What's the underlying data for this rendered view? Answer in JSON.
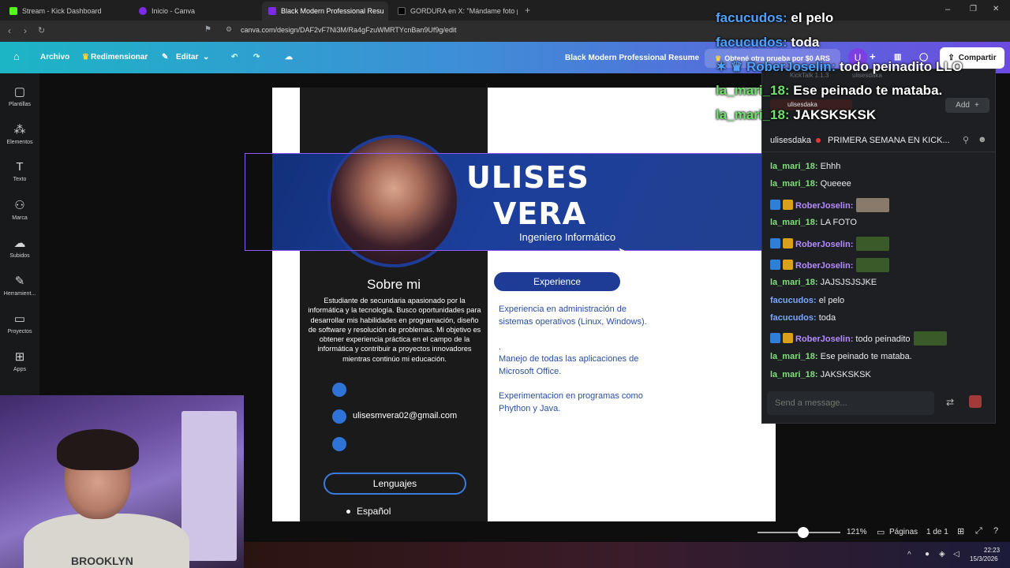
{
  "browser": {
    "tabs": [
      {
        "label": "Stream - Kick Dashboard",
        "color": "#53fc18"
      },
      {
        "label": "Inicio - Canva",
        "color": "#7d2ae8"
      },
      {
        "label": "Black Modern Professional Resu",
        "color": "#7d2ae8"
      },
      {
        "label": "GORDURA en X: \"Mándame foto par",
        "color": "#000000"
      }
    ],
    "url": "canva.com/design/DAF2vF7Ni3M/Ra4gFzuWMRTYcnBan9Uf9g/edit"
  },
  "canva": {
    "menu": {
      "file": "Archivo",
      "resize": "Redimensionar",
      "edit": "Editar"
    },
    "doc_title": "Black Modern Professional Resume",
    "trial": "Obtené otra prueba por $0 ARS",
    "avatar": "U",
    "share": "Compartir",
    "sidebar": [
      {
        "label": "Plantillas",
        "icon": "template-icon"
      },
      {
        "label": "Elementos",
        "icon": "elements-icon"
      },
      {
        "label": "Texto",
        "icon": "text-icon"
      },
      {
        "label": "Marca",
        "icon": "brand-icon"
      },
      {
        "label": "Subidos",
        "icon": "upload-icon"
      },
      {
        "label": "Herramient...",
        "icon": "tools-icon"
      },
      {
        "label": "Proyectos",
        "icon": "folder-icon"
      },
      {
        "label": "Apps",
        "icon": "apps-icon"
      }
    ],
    "status": {
      "zoom": "121%",
      "pages_label": "Páginas",
      "page_count": "1 de 1",
      "zoom_level": 0.55
    }
  },
  "resume": {
    "first_name": "ULISES",
    "last_name": "VERA",
    "role": "Ingeniero Informático",
    "about_heading": "Sobre mi",
    "about_text": "Estudiante de secundaria apasionado por la informática y la tecnología. Busco oportunidades para desarrollar mis habilidades en programación, diseño de software y resolución de problemas. Mi objetivo es obtener experiencia práctica en el campo de la informática y contribuir a proyectos innovadores mientras continúo mi educación.",
    "email": "ulisesmvera02@gmail.com",
    "languages_heading": "Lenguajes",
    "language_1": "Español",
    "experience_heading": "Experience",
    "experience_1": "Experiencia en administración de sistemas operativos (Linux, Windows).",
    "experience_dot": ".",
    "experience_2": "Manejo de todas las aplicaciones de Microsoft Office.",
    "experience_3": "Experimentacion en programas como Phython y Java."
  },
  "kicktalk": {
    "window_title": "KickTalk 1.1.3",
    "window_user": "ulisesdaka",
    "channel_tab": "ulisesdaka",
    "add_label": "Add",
    "streamer": "ulisesdaka",
    "stream_title": "PRIMERA SEMANA EN KICK...",
    "messages": [
      {
        "user": "la_mari_18",
        "text": "Ehhh"
      },
      {
        "user": "la_mari_18",
        "text": "Queeee"
      },
      {
        "user": "RoberJoselin",
        "text": ""
      },
      {
        "user": "la_mari_18",
        "text": "LA FOTO"
      },
      {
        "user": "RoberJoselin",
        "text": ""
      },
      {
        "user": "RoberJoselin",
        "text": ""
      },
      {
        "user": "la_mari_18",
        "text": "JAJSJSJSJKE"
      },
      {
        "user": "facucudos",
        "text": "el pelo"
      },
      {
        "user": "facucudos",
        "text": "toda"
      },
      {
        "user": "RoberJoselin",
        "text": "todo peinadito"
      },
      {
        "user": "la_mari_18",
        "text": "Ese peinado te mataba."
      },
      {
        "user": "la_mari_18",
        "text": "JAKSKSKSK"
      }
    ],
    "input_placeholder": "Send a message..."
  },
  "overlay_chat": [
    {
      "user": "facucudos",
      "text": "el pelo"
    },
    {
      "user": "facucudos",
      "text": "toda"
    },
    {
      "user": "RoberJoselin",
      "text": "todo peinadito",
      "suffix": "LLO"
    },
    {
      "user": "la_mari_18",
      "text": "Ese peinado te mataba."
    },
    {
      "user": "la_mari_18",
      "text": "JAKSKSKSK"
    }
  ],
  "webcam": {
    "shirt_text": "BROOKLYN"
  },
  "taskbar": {
    "time": "22:23",
    "date": "15/3/2026"
  }
}
